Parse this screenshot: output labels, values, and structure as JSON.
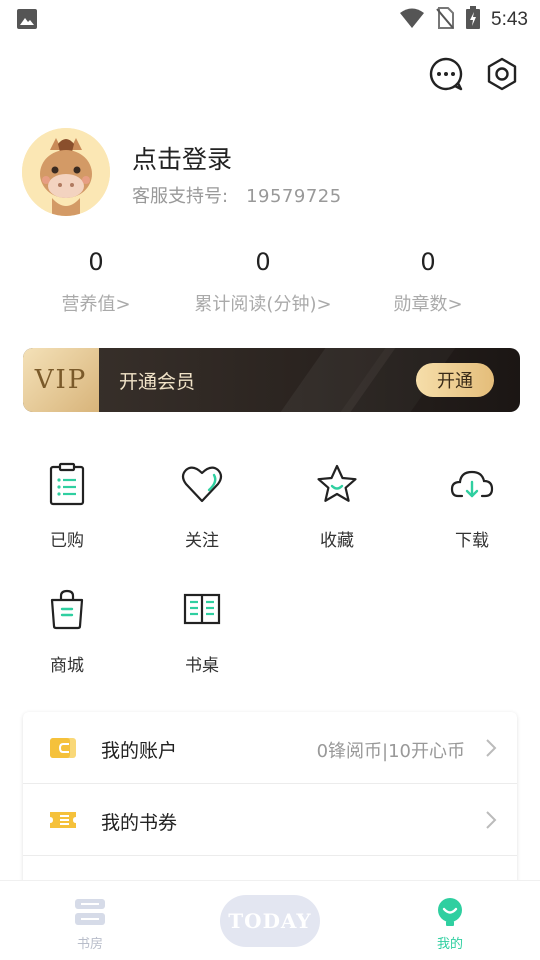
{
  "status_bar": {
    "time": "5:43"
  },
  "profile": {
    "login_text": "点击登录",
    "support_label": "客服支持号:",
    "support_number": "19579725"
  },
  "stats": [
    {
      "value": "0",
      "label": "营养值>"
    },
    {
      "value": "0",
      "label": "累计阅读(分钟)>"
    },
    {
      "value": "0",
      "label": "勋章数>"
    }
  ],
  "vip": {
    "badge": "VIP",
    "title": "开通会员",
    "button": "开通"
  },
  "grid": [
    {
      "label": "已购",
      "icon": "clipboard-icon"
    },
    {
      "label": "关注",
      "icon": "heart-icon"
    },
    {
      "label": "收藏",
      "icon": "star-icon"
    },
    {
      "label": "下载",
      "icon": "cloud-download-icon"
    },
    {
      "label": "商城",
      "icon": "shopping-bag-icon"
    },
    {
      "label": "书桌",
      "icon": "book-icon"
    }
  ],
  "account": {
    "rows": [
      {
        "title": "我的账户",
        "value": "0锋阅币|10开心币",
        "icon": "wallet-icon"
      },
      {
        "title": "我的书券",
        "value": "",
        "icon": "ticket-icon"
      }
    ]
  },
  "bottom_nav": {
    "items": [
      {
        "label": "书房",
        "icon": "bookshelf-icon",
        "active": false
      },
      {
        "label": "TODAY",
        "icon": "today-badge",
        "active": false
      },
      {
        "label": "我的",
        "icon": "profile-icon",
        "active": true
      }
    ]
  },
  "colors": {
    "accent": "#2fcfa0",
    "vip_gold": "#e4bd7a",
    "vip_dark": "#2b2420",
    "icon_yellow": "#f5c13b"
  }
}
